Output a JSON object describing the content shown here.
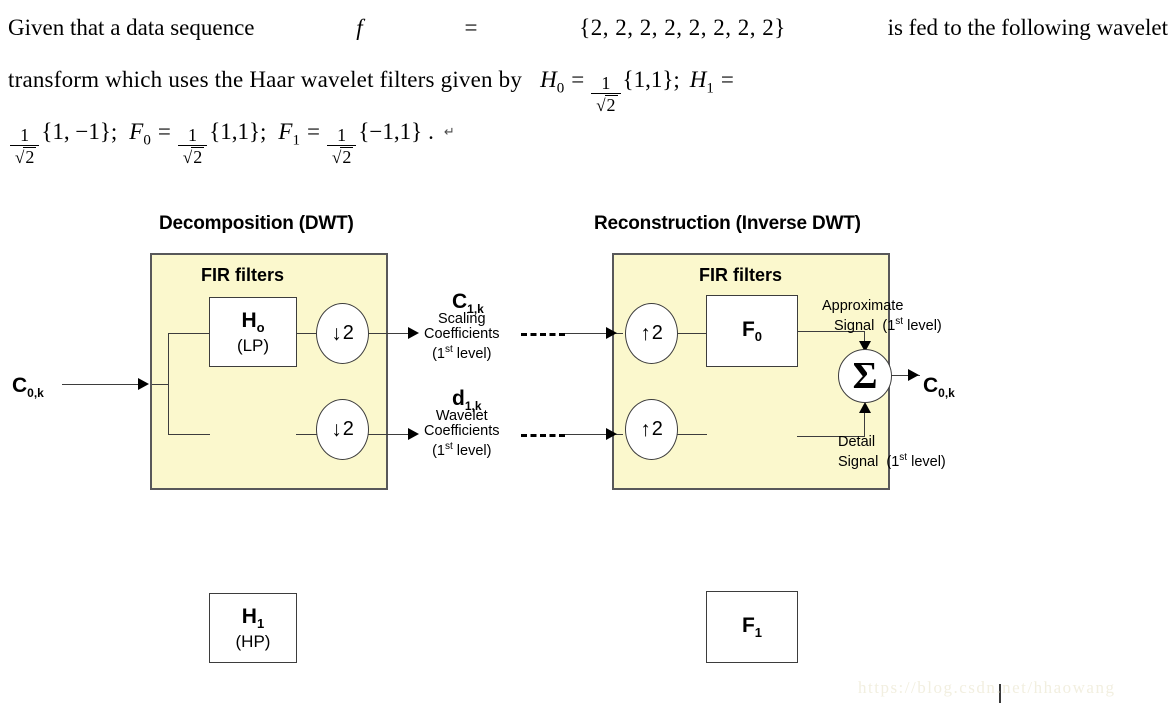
{
  "problem": {
    "line1_a": "Given  that  a  data  sequence",
    "line1_f": "f",
    "line1_eq": "=",
    "line1_seq": "{2, 2, 2, 2, 2, 2, 2, 2}",
    "line1_b": "is  fed  to  the  following  wavelet",
    "line2_a": "transform   which   uses   the   Haar   wavelet   filters   given   by",
    "line2_h0": "H",
    "line2_h0_sub": "0",
    "line2_eq1": "=",
    "line2_frac_num": "1",
    "line2_frac_den_radicand": "2",
    "line2_set1": "{1,1};",
    "line2_h1": "H",
    "line2_h1_sub": "1",
    "line2_eq2": "=",
    "line3_set_h1": "{1, −1};",
    "line3_f0": "F",
    "line3_f0_sub": "0",
    "line3_eq1": "=",
    "line3_set_f0": "{1,1};",
    "line3_f1": "F",
    "line3_f1_sub": "1",
    "line3_eq2": "=",
    "line3_set_f1": "{−1,1}",
    "line3_period": ".",
    "line3_return_char": "↵",
    "sqrt_symbol": "√",
    "radicand": "2",
    "fraction_numerator": "1"
  },
  "diagram": {
    "titles": {
      "decomposition": "Decomposition (DWT)",
      "reconstruction": "Reconstruction (Inverse DWT)"
    },
    "fir_label_left": "FIR filters",
    "fir_label_right": "FIR filters",
    "filters": {
      "h0": {
        "main": "H",
        "sub": "o",
        "type": "(LP)"
      },
      "h1": {
        "main": "H",
        "sub": "1",
        "type": "(HP)"
      },
      "f0": {
        "main": "F",
        "sub": "0"
      },
      "f1": {
        "main": "F",
        "sub": "1"
      }
    },
    "samplers": {
      "down_top": {
        "arrow": "↓",
        "factor": "2"
      },
      "down_bottom": {
        "arrow": "↓",
        "factor": "2"
      },
      "up_top": {
        "arrow": "↑",
        "factor": "2"
      },
      "up_bottom": {
        "arrow": "↑",
        "factor": "2"
      }
    },
    "summation_symbol": "Σ",
    "input_label": {
      "main": "C",
      "sub": "0,k"
    },
    "output_label": {
      "main": "C",
      "sub": "0,k"
    },
    "scaling": {
      "symbol_main": "C",
      "symbol_sub": "1,k",
      "line1": "Scaling",
      "line2": "Coefficients",
      "line3_pre": "(1",
      "line3_sup": "st",
      "line3_post": " level)"
    },
    "wavelet": {
      "symbol_main": "d",
      "symbol_sub": "1,k",
      "line1": "Wavelet",
      "line2": "Coefficients",
      "line3_pre": "(1",
      "line3_sup": "st",
      "line3_post": " level)"
    },
    "approximate_signal": {
      "line1": "Approximate",
      "line2": "Signal",
      "level_pre": "(1",
      "level_sup": "st",
      "level_post": " level)"
    },
    "detail_signal": {
      "line1": "Detail",
      "line2": "Signal",
      "level_pre": "(1",
      "level_sup": "st",
      "level_post": " level)"
    },
    "colors": {
      "panel_fill": "#fbf8cd",
      "panel_border": "#58585a",
      "block_border": "#3d3d3d",
      "wire": "#3d3d3d"
    }
  },
  "watermark": "https://blog.csdn.net/hhaowang"
}
